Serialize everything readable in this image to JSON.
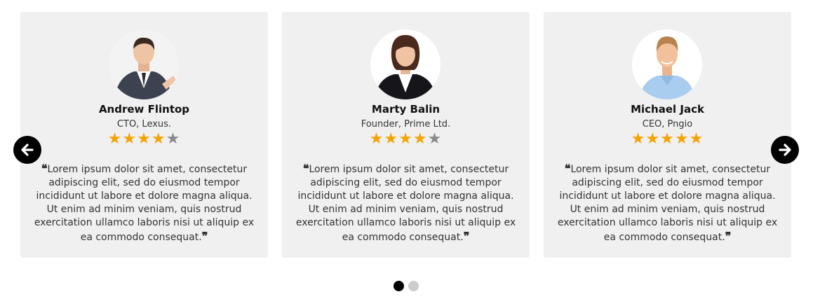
{
  "testimonials": [
    {
      "name": "Andrew Flintop",
      "role": "CTO, Lexus.",
      "rating": 4,
      "open_quote": "❝",
      "quote": "Lorem ipsum dolor sit amet, consectetur adipiscing elit, sed do eiusmod tempor incididunt ut labore et dolore magna aliqua. Ut enim ad minim veniam, quis nostrud exercitation ullamco laboris nisi ut aliquip ex ea commodo consequat.",
      "close_quote": "❞"
    },
    {
      "name": "Marty Balin",
      "role": "Founder, Prime Ltd.",
      "rating": 4,
      "open_quote": "❝",
      "quote": "Lorem ipsum dolor sit amet, consectetur adipiscing elit, sed do eiusmod tempor incididunt ut labore et dolore magna aliqua. Ut enim ad minim veniam, quis nostrud exercitation ullamco laboris nisi ut aliquip ex ea commodo consequat.",
      "close_quote": "❞"
    },
    {
      "name": "Michael Jack",
      "role": "CEO, Pngio",
      "rating": 5,
      "open_quote": "❝",
      "quote": "Lorem ipsum dolor sit amet, consectetur adipiscing elit, sed do eiusmod tempor incididunt ut labore et dolore magna aliqua. Ut enim ad minim veniam, quis nostrud exercitation ullamco laboris nisi ut aliquip ex ea commodo consequat.",
      "close_quote": "❞"
    }
  ],
  "rating_max": 5,
  "star_glyph": "★",
  "carousel": {
    "prev_icon": "arrow-left-icon",
    "next_icon": "arrow-right-icon",
    "pages": 2,
    "active_page": 1
  },
  "colors": {
    "card_bg": "#f0f0f0",
    "star_on": "#f5a300",
    "star_off": "#8a8a8a",
    "arrow_bg": "#000000",
    "dot_active": "#000000",
    "dot_inactive": "#cccccc"
  }
}
